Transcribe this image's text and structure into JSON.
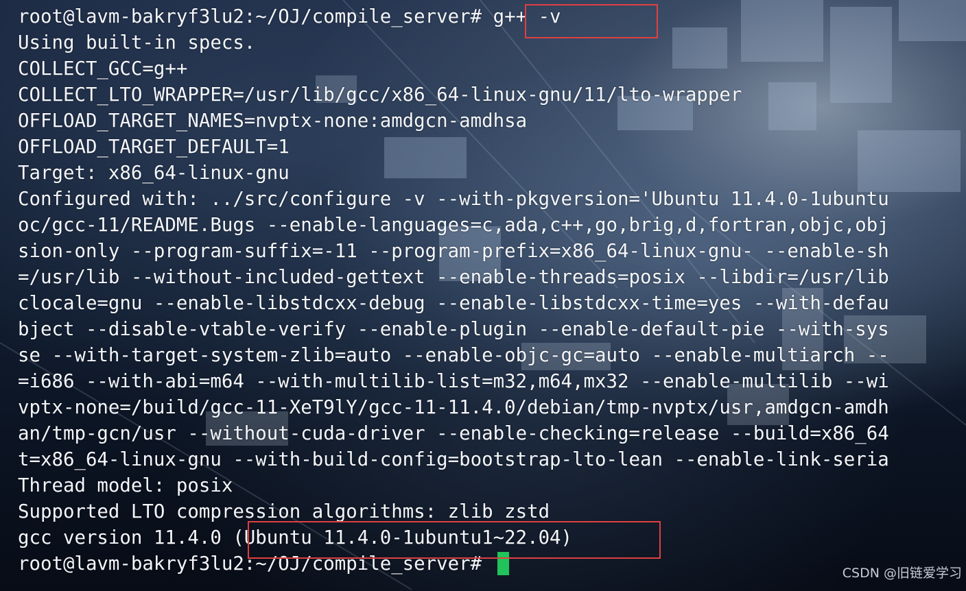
{
  "terminal": {
    "lines": [
      "root@lavm-bakryf3lu2:~/OJ/compile_server# g++ -v",
      "Using built-in specs.",
      "COLLECT_GCC=g++",
      "COLLECT_LTO_WRAPPER=/usr/lib/gcc/x86_64-linux-gnu/11/lto-wrapper",
      "OFFLOAD_TARGET_NAMES=nvptx-none:amdgcn-amdhsa",
      "OFFLOAD_TARGET_DEFAULT=1",
      "Target: x86_64-linux-gnu",
      "Configured with: ../src/configure -v --with-pkgversion='Ubuntu 11.4.0-1ubuntu",
      "oc/gcc-11/README.Bugs --enable-languages=c,ada,c++,go,brig,d,fortran,objc,obj",
      "sion-only --program-suffix=-11 --program-prefix=x86_64-linux-gnu- --enable-sh",
      "=/usr/lib --without-included-gettext --enable-threads=posix --libdir=/usr/lib",
      "clocale=gnu --enable-libstdcxx-debug --enable-libstdcxx-time=yes --with-defau",
      "bject --disable-vtable-verify --enable-plugin --enable-default-pie --with-sys",
      "se --with-target-system-zlib=auto --enable-objc-gc=auto --enable-multiarch --",
      "=i686 --with-abi=m64 --with-multilib-list=m32,m64,mx32 --enable-multilib --wi",
      "vptx-none=/build/gcc-11-XeT9lY/gcc-11-11.4.0/debian/tmp-nvptx/usr,amdgcn-amdh",
      "an/tmp-gcn/usr --without-cuda-driver --enable-checking=release --build=x86_64",
      "t=x86_64-linux-gnu --with-build-config=bootstrap-lto-lean --enable-link-seria",
      "Thread model: posix",
      "Supported LTO compression algorithms: zlib zstd",
      "gcc version 11.4.0 (Ubuntu 11.4.0-1ubuntu1~22.04)"
    ],
    "prompt": "root@lavm-bakryf3lu2:~/OJ/compile_server# "
  },
  "watermark": "CSDN @旧链爱学习",
  "colors": {
    "text": "#f4f6fa",
    "cursor": "#20c45a",
    "highlight": "#e04040"
  }
}
